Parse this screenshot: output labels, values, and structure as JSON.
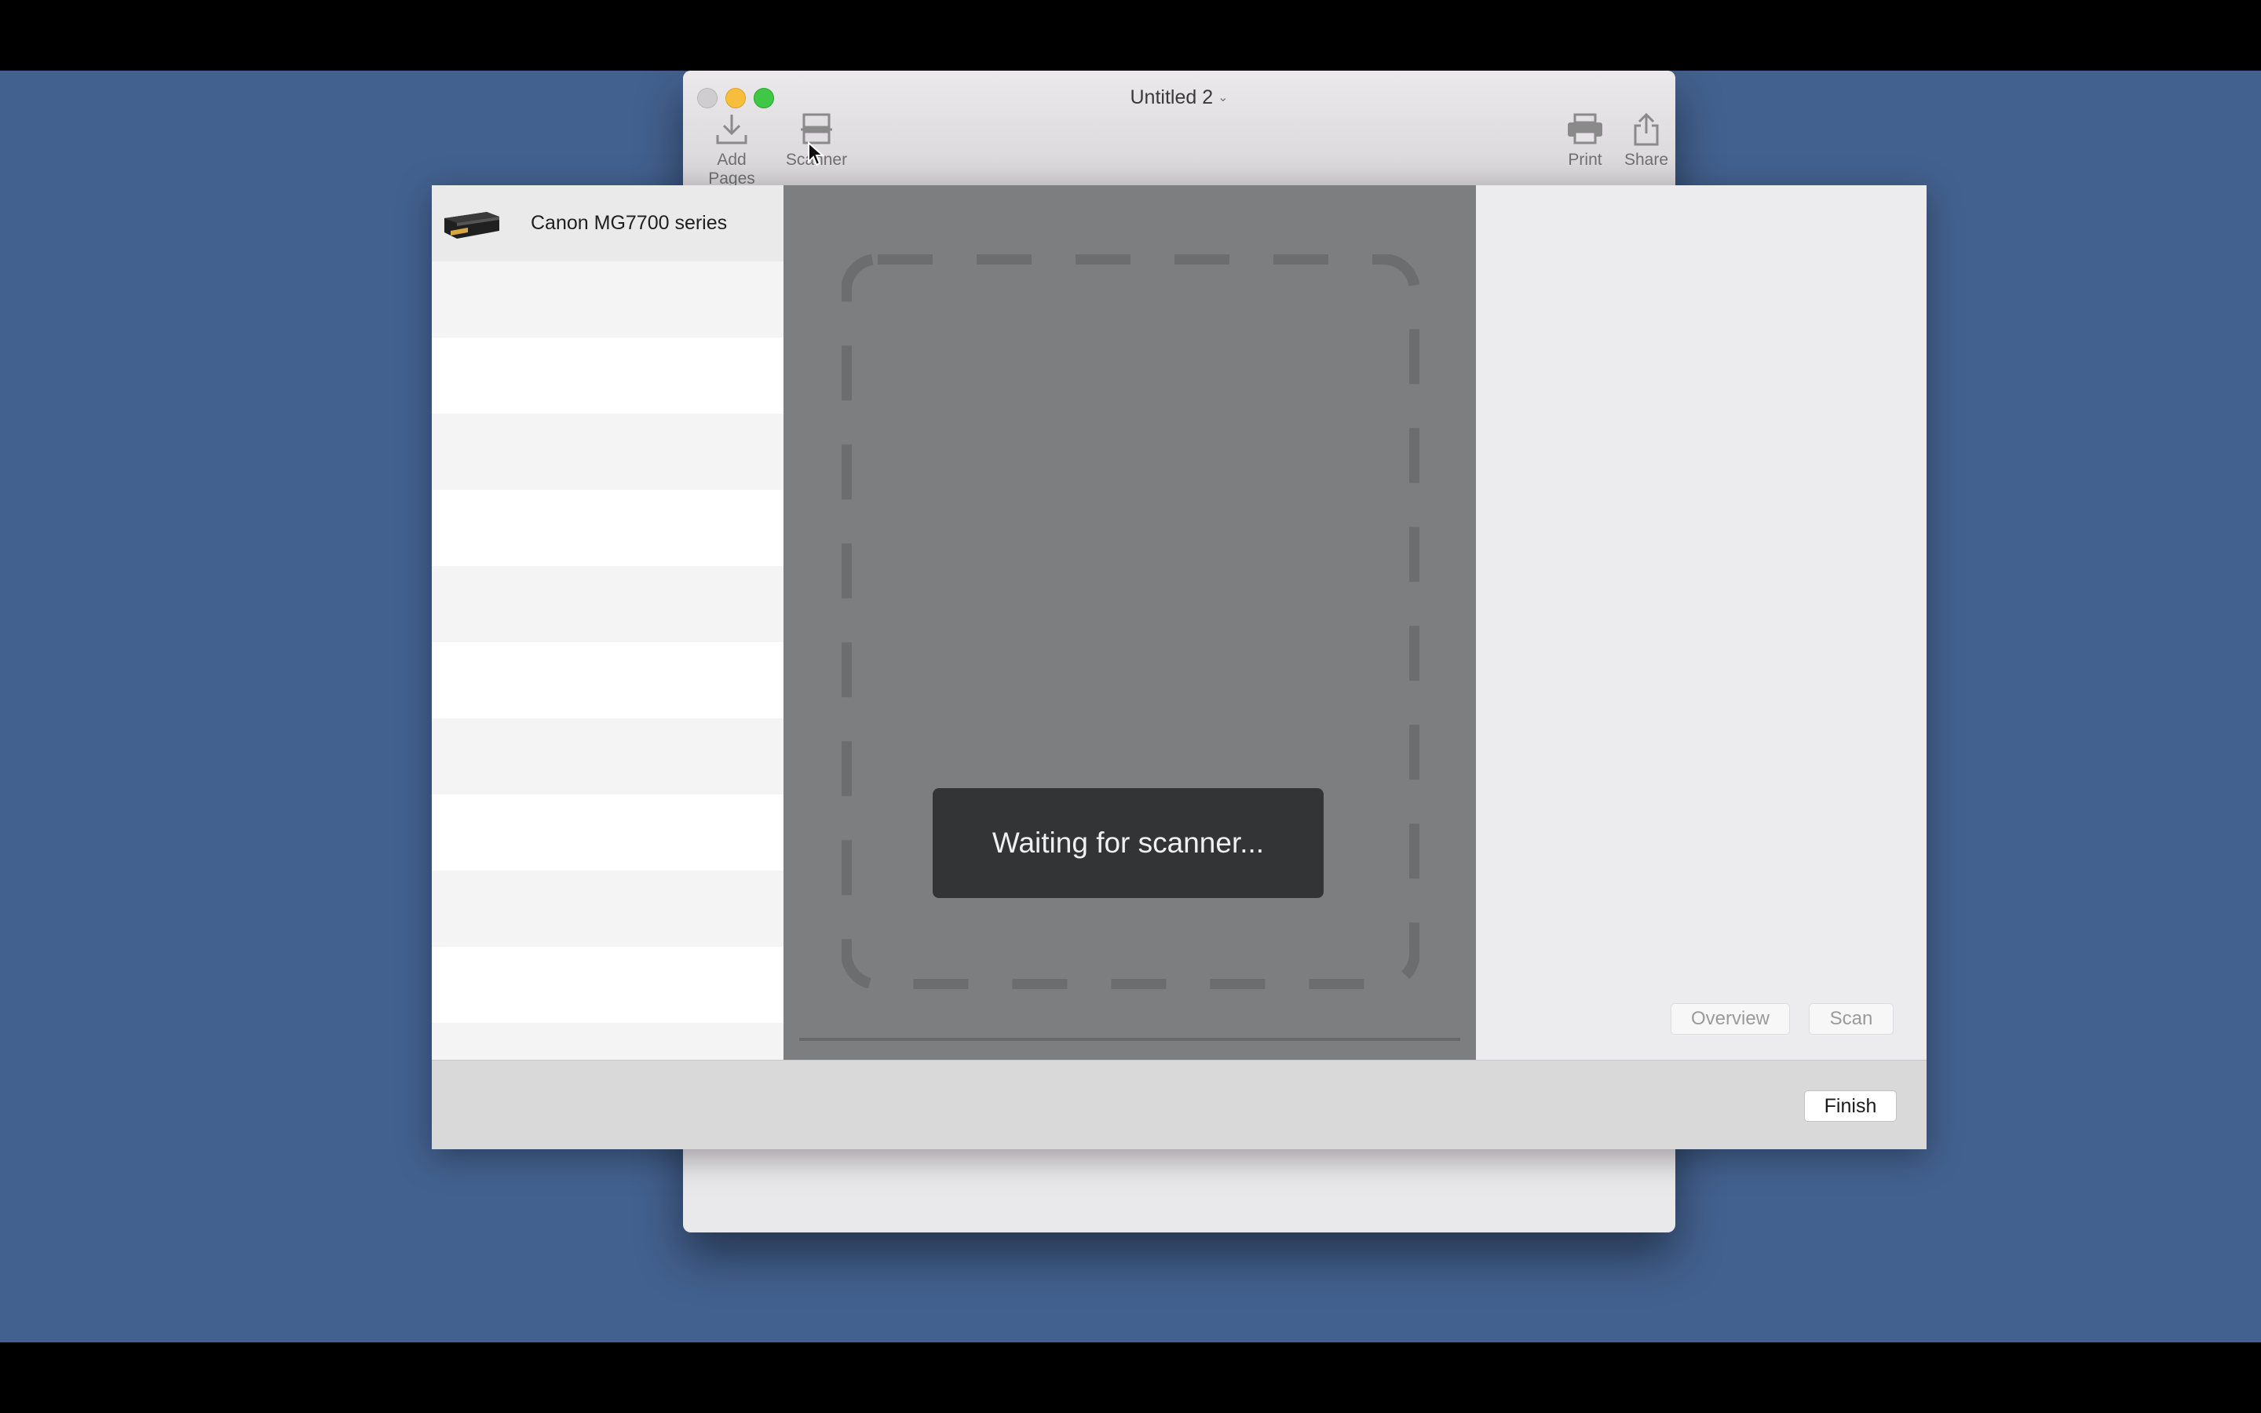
{
  "window": {
    "title": "Untitled 2",
    "title_menu_icon": "chevron-down-icon"
  },
  "toolbar": {
    "add_pages": {
      "label": "Add Pages",
      "icon": "download-tray-icon"
    },
    "scanner": {
      "label": "Scanner",
      "icon": "scanner-icon"
    },
    "print": {
      "label": "Print",
      "icon": "printer-icon"
    },
    "share": {
      "label": "Share",
      "icon": "share-icon"
    }
  },
  "scanner_sheet": {
    "devices": [
      {
        "name": "Canon MG7700 series",
        "icon": "printer-scanner-icon",
        "selected": true
      }
    ],
    "status": "Waiting for scanner...",
    "buttons": {
      "overview": "Overview",
      "scan": "Scan",
      "finish": "Finish"
    }
  },
  "colors": {
    "desktop": "#43618f",
    "preview_background": "#7c7e80",
    "hud_background": "#333435"
  }
}
